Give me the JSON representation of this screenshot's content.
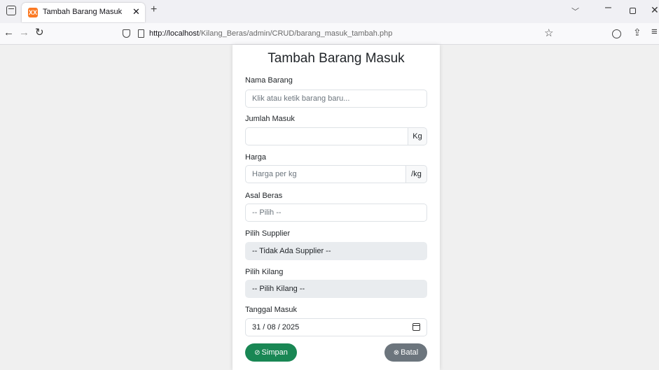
{
  "browser": {
    "tab_title": "Tambah Barang Masuk",
    "favicon_glyph": "XX",
    "url_host": "http://localhost",
    "url_path": "/Kilang_Beras/admin/CRUD/barang_masuk_tambah.php"
  },
  "form": {
    "title": "Tambah Barang Masuk",
    "nama_barang": {
      "label": "Nama Barang",
      "placeholder": "Klik atau ketik barang baru..."
    },
    "jumlah_masuk": {
      "label": "Jumlah Masuk",
      "value": "",
      "unit": "Kg"
    },
    "harga": {
      "label": "Harga",
      "placeholder": "Harga per kg",
      "unit": "/kg"
    },
    "asal_beras": {
      "label": "Asal Beras",
      "selected": "-- Pilih --"
    },
    "supplier": {
      "label": "Pilih Supplier",
      "selected": "-- Tidak Ada Supplier --"
    },
    "kilang": {
      "label": "Pilih Kilang",
      "selected": "-- Pilih Kilang --"
    },
    "tanggal_masuk": {
      "label": "Tanggal Masuk",
      "value": "31 / 08 / 2025"
    },
    "save_label": "Simpan",
    "cancel_label": "Batal"
  },
  "colors": {
    "save": "#198754",
    "cancel": "#6c757d",
    "disabled_bg": "#e9ecef"
  },
  "icons": {
    "save": "check-circle-icon",
    "cancel": "x-circle-icon",
    "date": "calendar-icon"
  }
}
